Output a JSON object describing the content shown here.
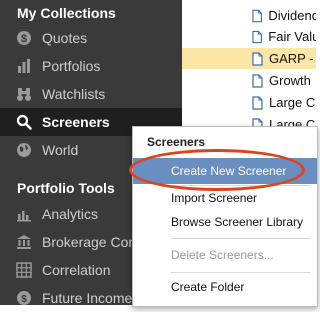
{
  "sidebar": {
    "collections_title": "My Collections",
    "collections": [
      {
        "label": "Quotes",
        "icon": "dollar-icon"
      },
      {
        "label": "Portfolios",
        "icon": "portfolio-icon"
      },
      {
        "label": "Watchlists",
        "icon": "binoculars-icon"
      },
      {
        "label": "Screeners",
        "icon": "search-icon",
        "active": true
      },
      {
        "label": "World",
        "icon": "globe-icon"
      }
    ],
    "tools_title": "Portfolio Tools",
    "tools": [
      {
        "label": "Analytics",
        "icon": "bar-chart-icon"
      },
      {
        "label": "Brokerage Conn",
        "icon": "bank-icon"
      },
      {
        "label": "Correlation",
        "icon": "grid-icon"
      },
      {
        "label": "Future Income",
        "icon": "coin-icon"
      }
    ]
  },
  "files": [
    {
      "label": "Dividend"
    },
    {
      "label": "Fair Valu"
    },
    {
      "label": "GARP -",
      "selected": true
    },
    {
      "label": "Growth"
    },
    {
      "label": "Large C"
    },
    {
      "label": "Large C"
    }
  ],
  "context_menu": {
    "title": "Screeners",
    "items": [
      {
        "label": "Create New Screener",
        "highlight": true
      },
      {
        "label": "Import Screener"
      },
      {
        "label": "Browse Screener Library"
      },
      {
        "label": "Delete Screeners...",
        "disabled": true
      },
      {
        "label": "Create Folder"
      }
    ]
  },
  "colors": {
    "sidebar_bg": "#3a3a3a",
    "highlight": "#6a8ebf",
    "selected_row": "#fbe6a6",
    "annotation": "#e0421a"
  }
}
